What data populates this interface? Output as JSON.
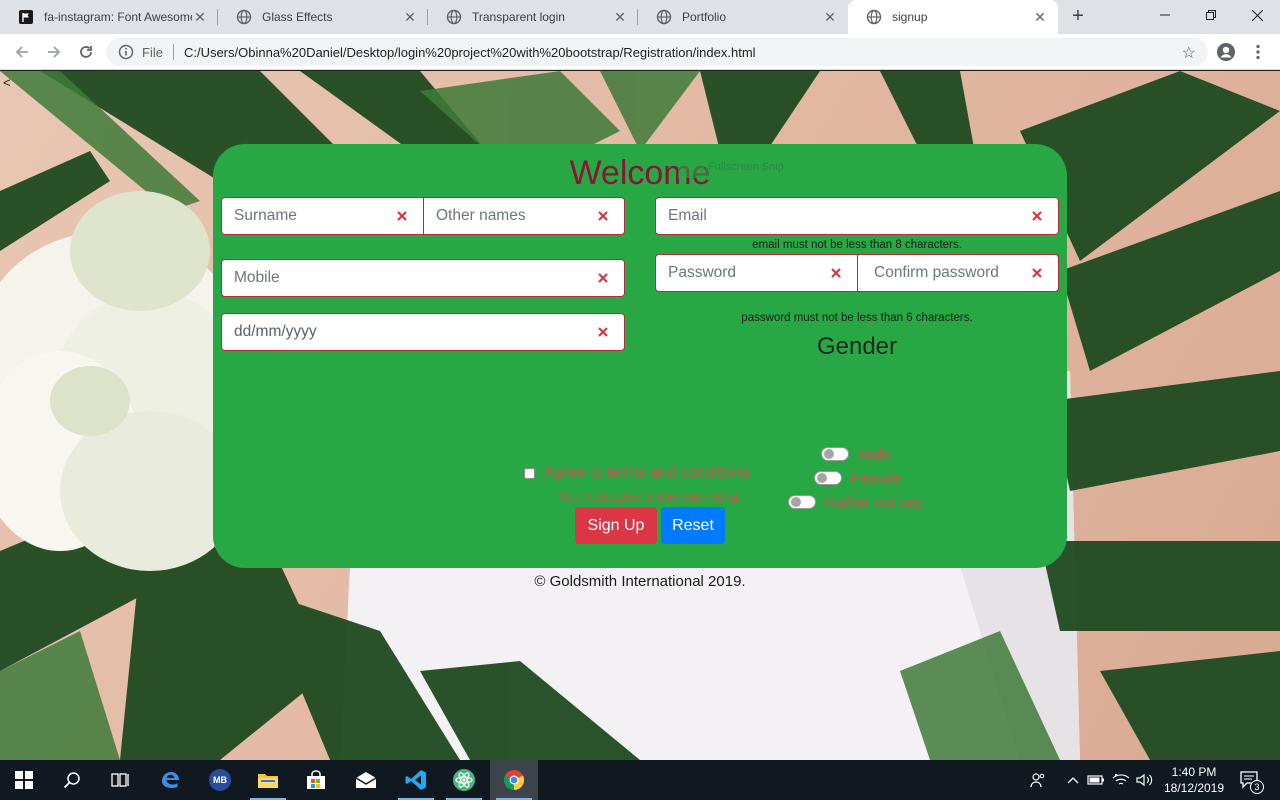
{
  "browser": {
    "tabs": [
      {
        "title": "fa-instagram: Font Awesome",
        "icon": "font-awesome-flag-icon"
      },
      {
        "title": "Glass Effects",
        "icon": "globe-icon"
      },
      {
        "title": "Transparent login",
        "icon": "globe-icon"
      },
      {
        "title": "Portfolio",
        "icon": "globe-icon"
      },
      {
        "title": "signup",
        "icon": "globe-icon",
        "active": true
      }
    ],
    "address": {
      "scheme_label": "File",
      "url": "C:/Users/Obinna%20Daniel/Desktop/login%20project%20with%20bootstrap/Registration/index.html"
    }
  },
  "page": {
    "corner_text": "<",
    "title": "Welcome",
    "overlay_text": "Fullscreen Snip",
    "fields": {
      "surname": {
        "placeholder": "Surname"
      },
      "other_names": {
        "placeholder": "Other names"
      },
      "mobile": {
        "placeholder": "Mobile"
      },
      "dob": {
        "placeholder": "dd/mm/yyyy"
      },
      "email": {
        "placeholder": "Email"
      },
      "password": {
        "placeholder": "Password"
      },
      "confirm_password": {
        "placeholder": "Confirm password"
      }
    },
    "email_hint": "email must not be less than 8 characters.",
    "password_hint": "password must not be less than 6 characters.",
    "gender": {
      "heading": "Gender",
      "options": [
        "Male",
        "Female",
        "Rather not say"
      ]
    },
    "terms": {
      "label": "Agree to terms and conditions",
      "invalid_feedback": "You must agree before submitting."
    },
    "buttons": {
      "signup": "Sign Up",
      "reset": "Reset"
    },
    "footer": "© Goldsmith International 2019."
  },
  "taskbar": {
    "mb_label": "MB",
    "clock_time": "1:40 PM",
    "clock_date": "18/12/2019",
    "notification_count": "3"
  },
  "colors": {
    "card": "#28a745",
    "welcome": "#8b1538",
    "signup_button": "#dc3545",
    "reset_button": "#007bff",
    "error_mark": "#dc3545"
  }
}
